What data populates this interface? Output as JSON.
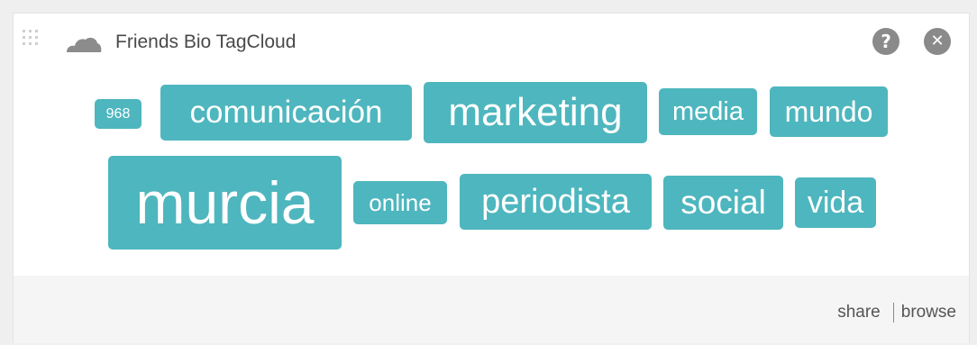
{
  "widget": {
    "title": "Friends Bio TagCloud",
    "help_label": "?",
    "close_label": "✕"
  },
  "tags": [
    {
      "label": "968"
    },
    {
      "label": "comunicación"
    },
    {
      "label": "marketing"
    },
    {
      "label": "media"
    },
    {
      "label": "mundo"
    },
    {
      "label": "murcia"
    },
    {
      "label": "online"
    },
    {
      "label": "periodista"
    },
    {
      "label": "social"
    },
    {
      "label": "vida"
    }
  ],
  "footer": {
    "share_label": "share",
    "browse_label": "browse"
  },
  "colors": {
    "tag_background": "#4eb6be",
    "tag_text": "#ffffff",
    "footer_background": "#f5f5f5"
  }
}
